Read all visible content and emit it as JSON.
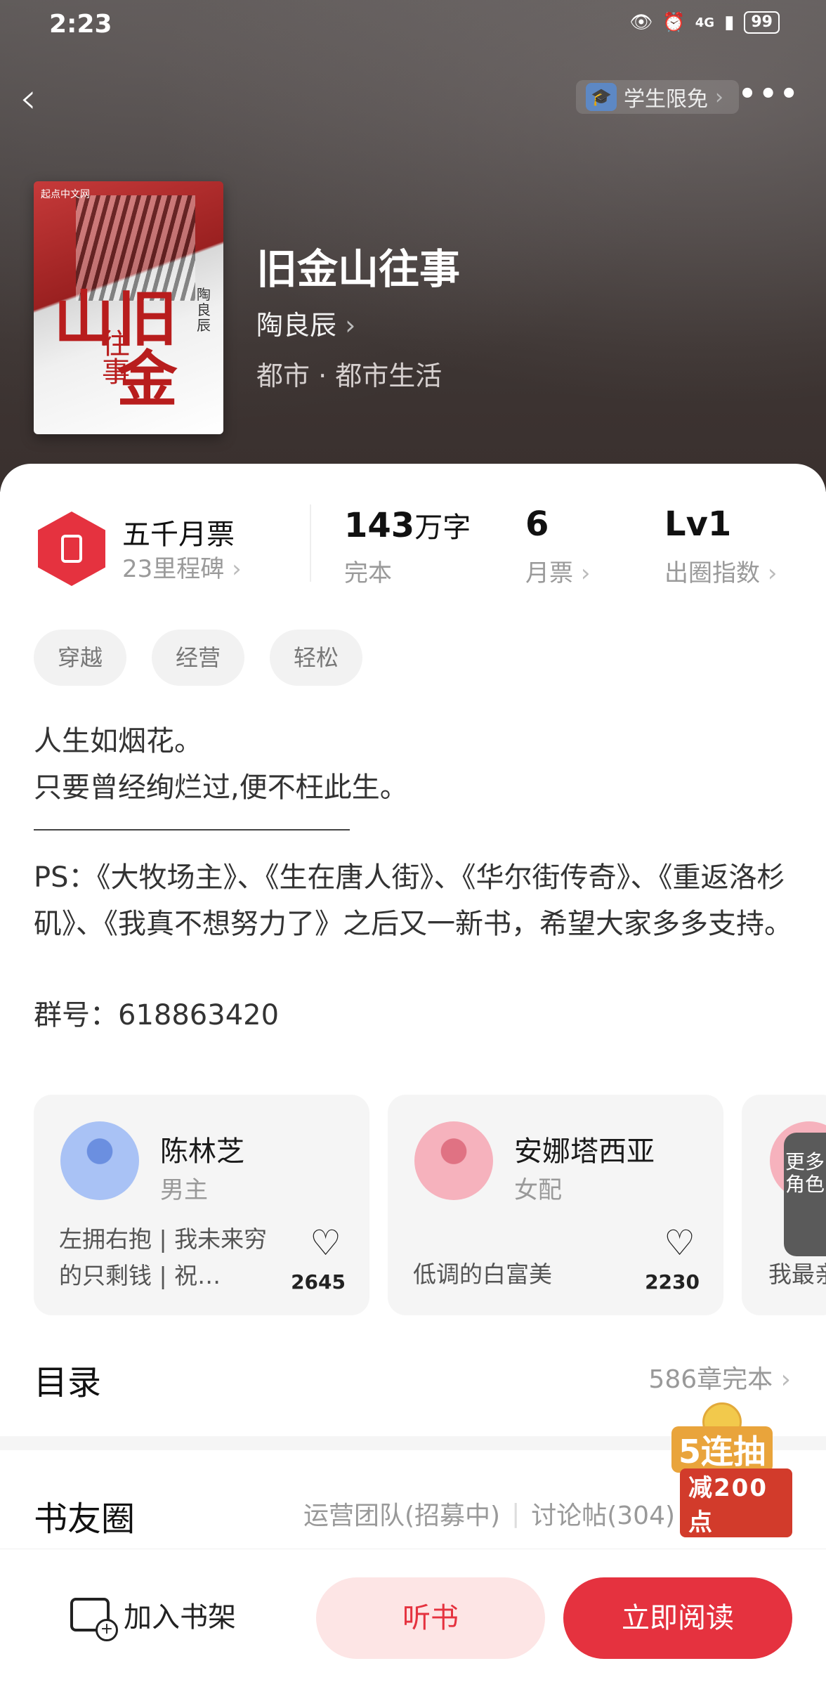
{
  "status_bar": {
    "time": "2:23",
    "network": "4G",
    "battery": "99"
  },
  "nav": {
    "back_icon": "chevron-left-icon",
    "student_label": "学生限免",
    "more_icon": "more-horizontal-icon"
  },
  "book": {
    "title": "旧金山往事",
    "author": "陶良辰",
    "genre": "都市 · 都市生活",
    "cover": {
      "brand": "起点中文网",
      "big_text": "旧金山",
      "sub_text": "往事",
      "author_text": "陶良辰"
    }
  },
  "stats": {
    "monthly_ticket_title": "五千月票",
    "monthly_ticket_sub": "23里程碑",
    "words": "143",
    "words_unit": "万字",
    "words_sub": "完本",
    "tickets": "6",
    "tickets_sub": "月票",
    "index": "Lv1",
    "index_sub": "出圈指数"
  },
  "tags": [
    "穿越",
    "经营",
    "轻松"
  ],
  "description": {
    "line1": "人生如烟花。",
    "line2": "只要曾经绚烂过,便不枉此生。",
    "ps": "PS：《大牧场主》、《生在唐人街》、《华尔街传奇》、《重返洛杉矶》、《我真不想努力了》之后又一新书，希望大家多多支持。",
    "group": "群号：618863420"
  },
  "characters": [
    {
      "name": "陈林芝",
      "role": "男主",
      "desc": "左拥右抱 | 我未来穷的只剩钱 | 祝…",
      "likes": "2645"
    },
    {
      "name": "安娜塔西亚",
      "role": "女配",
      "desc": "低调的白富美",
      "likes": "2230"
    },
    {
      "desc_partial": "我最亲"
    }
  ],
  "more_roles": "更多角色",
  "catalog": {
    "title": "目录",
    "status": "586章完本"
  },
  "community": {
    "title": "书友圈",
    "team": "运营团队(招募中)",
    "posts": "讨论帖(304)"
  },
  "promo": {
    "text1": "5连抽",
    "text2": "减200点"
  },
  "bottom_bar": {
    "shelf": "加入书架",
    "listen": "听书",
    "read": "立即阅读"
  },
  "colors": {
    "accent": "#e5323f",
    "accent_light": "#fde5e5"
  }
}
